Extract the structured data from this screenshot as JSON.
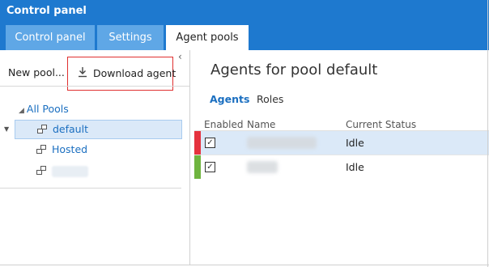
{
  "app": {
    "title": "Control panel",
    "accent_color": "#1e79cf"
  },
  "tabs": [
    {
      "label": "Control panel",
      "active": false
    },
    {
      "label": "Settings",
      "active": false
    },
    {
      "label": "Agent pools",
      "active": true
    }
  ],
  "left_pane": {
    "collapse_icon": "chevron-left-icon",
    "toolbar": {
      "new_pool_label": "New pool...",
      "download_agent_label": "Download agent",
      "download_icon": "download-icon"
    },
    "tree": {
      "root_label": "All Pools",
      "pools": [
        {
          "label": "default",
          "selected": true
        },
        {
          "label": "Hosted",
          "selected": false
        },
        {
          "label": "",
          "selected": false,
          "redacted": true
        }
      ]
    }
  },
  "right_pane": {
    "title": "Agents for pool default",
    "subtabs": [
      {
        "label": "Agents",
        "active": true
      },
      {
        "label": "Roles",
        "active": false
      }
    ],
    "columns": [
      "Enabled",
      "Name",
      "Current Status"
    ],
    "agents": [
      {
        "enabled": true,
        "name": "",
        "name_redacted": true,
        "status": "Idle",
        "indicator_color": "#e5323e",
        "selected": true
      },
      {
        "enabled": true,
        "name": "",
        "name_redacted": true,
        "status": "Idle",
        "indicator_color": "#6fb43f",
        "selected": false
      }
    ]
  }
}
